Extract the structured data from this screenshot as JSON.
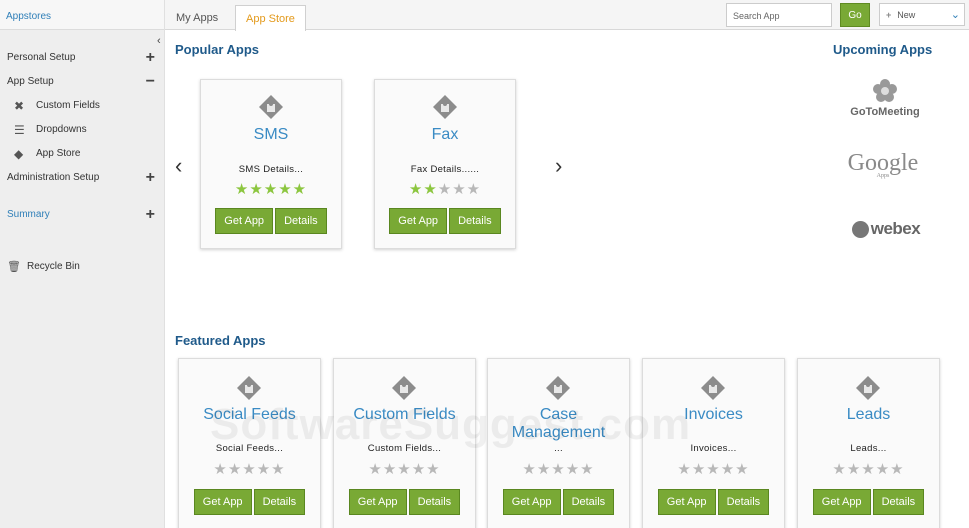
{
  "sidebar": {
    "header": "Appstores",
    "items": [
      {
        "label": "Personal Setup",
        "toggle": "+"
      },
      {
        "label": "App Setup",
        "toggle": "−"
      },
      {
        "label": "Custom Fields",
        "icon": "tools-icon"
      },
      {
        "label": "Dropdowns",
        "icon": "list-icon"
      },
      {
        "label": "App Store",
        "icon": "puzzle-icon"
      },
      {
        "label": "Administration Setup",
        "toggle": "+"
      },
      {
        "label": "Summary",
        "toggle": "+"
      },
      {
        "label": "Recycle Bin",
        "icon": "trash-icon"
      }
    ]
  },
  "tabs": [
    {
      "label": "My Apps",
      "active": false
    },
    {
      "label": "App Store",
      "active": true
    }
  ],
  "search": {
    "placeholder": "Search App",
    "go_label": "Go"
  },
  "new_button": {
    "label": "New"
  },
  "popular": {
    "title": "Popular Apps",
    "apps": [
      {
        "name": "SMS",
        "desc": "SMS Details...",
        "rating": 5,
        "get_label": "Get App",
        "details_label": "Details"
      },
      {
        "name": "Fax",
        "desc": "Fax Details......",
        "rating": 2,
        "get_label": "Get App",
        "details_label": "Details"
      }
    ]
  },
  "upcoming": {
    "title": "Upcoming Apps",
    "logos": [
      "GoToMeeting",
      "Google",
      "webex"
    ],
    "google_sub": "Apps"
  },
  "featured": {
    "title": "Featured Apps",
    "apps": [
      {
        "name": "Social Feeds",
        "desc": "Social Feeds...",
        "rating": 0,
        "get_label": "Get App",
        "details_label": "Details"
      },
      {
        "name": "Custom Fields",
        "desc": "Custom Fields...",
        "rating": 0,
        "get_label": "Get App",
        "details_label": "Details"
      },
      {
        "name": "Case Management",
        "desc": "...",
        "rating": 0,
        "get_label": "Get App",
        "details_label": "Details"
      },
      {
        "name": "Invoices",
        "desc": "Invoices...",
        "rating": 0,
        "get_label": "Get App",
        "details_label": "Details"
      },
      {
        "name": "Leads",
        "desc": "Leads...",
        "rating": 0,
        "get_label": "Get App",
        "details_label": "Details"
      }
    ]
  },
  "watermark": "SoftwareSuggest.com",
  "colors": {
    "accent_green": "#79a935",
    "link_blue": "#2f7fb8",
    "title_blue": "#1f5a8a",
    "tab_active": "#e39a1c",
    "star_on": "#8cc63f",
    "star_off": "#b8b8b8"
  }
}
